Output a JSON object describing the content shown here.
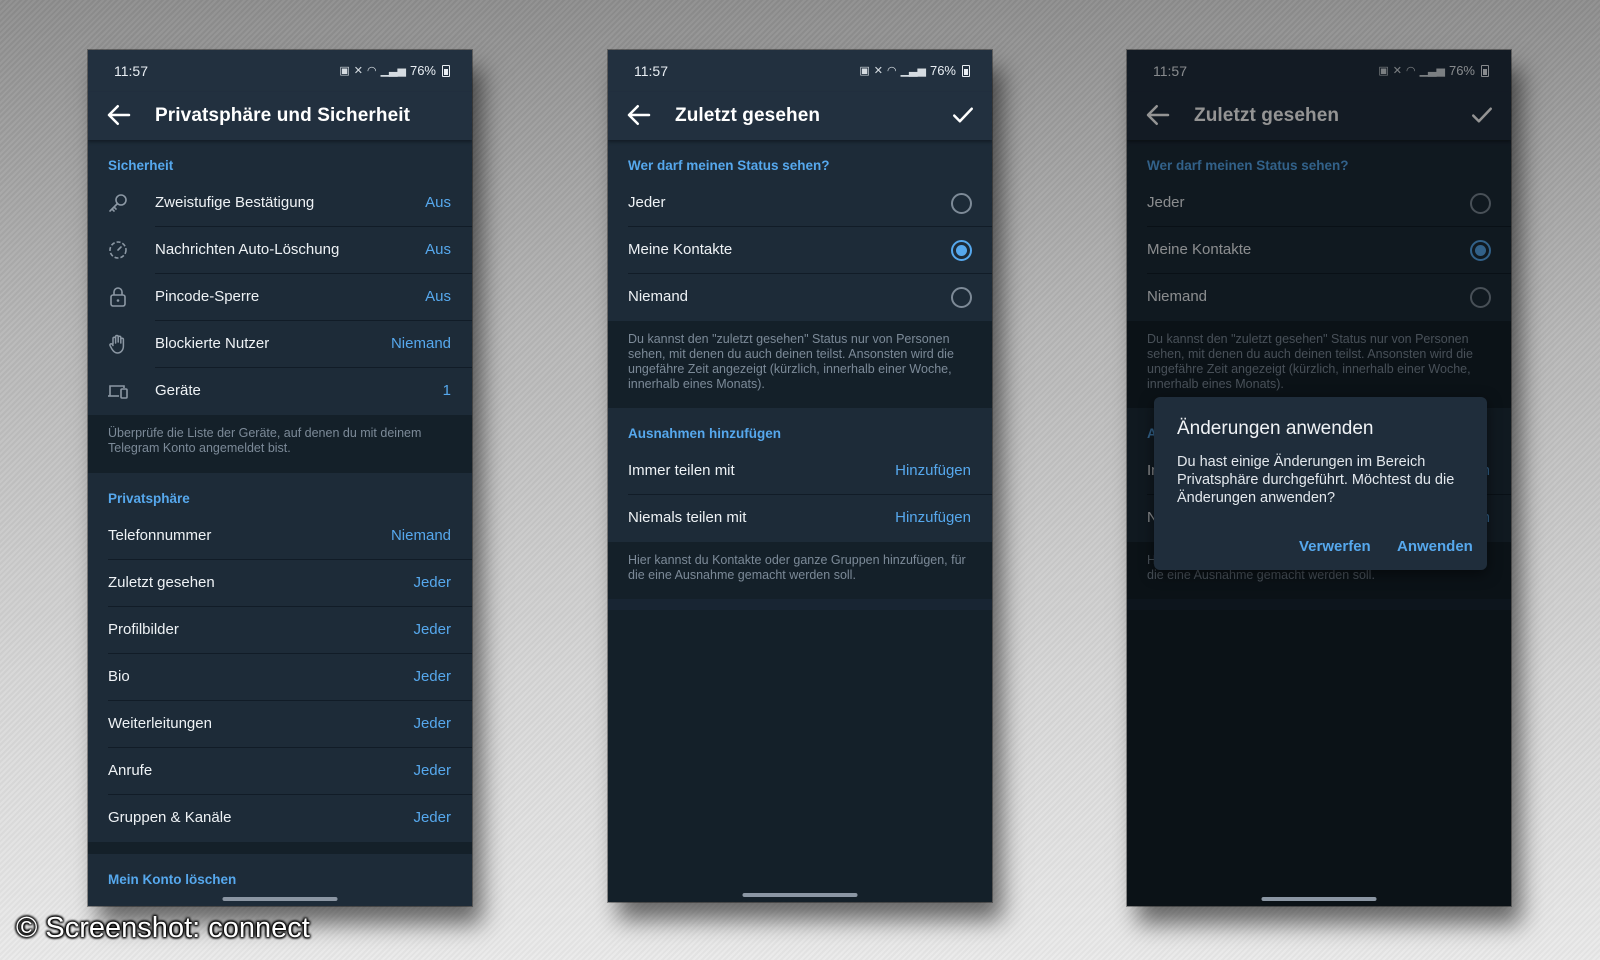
{
  "statusbar": {
    "time": "11:57",
    "battery": "76%"
  },
  "phone1": {
    "title": "Privatsphäre und Sicherheit",
    "security": {
      "header": "Sicherheit",
      "items": [
        {
          "label": "Zweistufige Bestätigung",
          "value": "Aus",
          "icon": "key-icon"
        },
        {
          "label": "Nachrichten Auto-Löschung",
          "value": "Aus",
          "icon": "timer-icon"
        },
        {
          "label": "Pincode-Sperre",
          "value": "Aus",
          "icon": "lock-icon"
        },
        {
          "label": "Blockierte Nutzer",
          "value": "Niemand",
          "icon": "hand-icon"
        },
        {
          "label": "Geräte",
          "value": "1",
          "icon": "devices-icon"
        }
      ],
      "info": "Überprüfe die Liste der Geräte, auf denen du mit deinem Telegram Konto angemeldet bist."
    },
    "privacy": {
      "header": "Privatsphäre",
      "items": [
        {
          "label": "Telefonnummer",
          "value": "Niemand"
        },
        {
          "label": "Zuletzt gesehen",
          "value": "Jeder"
        },
        {
          "label": "Profilbilder",
          "value": "Jeder"
        },
        {
          "label": "Bio",
          "value": "Jeder"
        },
        {
          "label": "Weiterleitungen",
          "value": "Jeder"
        },
        {
          "label": "Anrufe",
          "value": "Jeder"
        },
        {
          "label": "Gruppen & Kanäle",
          "value": "Jeder"
        }
      ]
    },
    "delete_header": "Mein Konto löschen"
  },
  "phone2": {
    "title": "Zuletzt gesehen",
    "question": "Wer darf meinen Status sehen?",
    "options": [
      {
        "label": "Jeder",
        "selected": false
      },
      {
        "label": "Meine Kontakte",
        "selected": true
      },
      {
        "label": "Niemand",
        "selected": false
      }
    ],
    "info": "Du kannst den \"zuletzt gesehen\" Status nur von Personen sehen, mit denen du auch deinen teilst. Ansonsten wird die ungefähre Zeit angezeigt (kürzlich, innerhalb einer Woche, innerhalb eines Monats).",
    "exceptions_header": "Ausnahmen hinzufügen",
    "exceptions": [
      {
        "label": "Immer teilen mit",
        "action": "Hinzufügen"
      },
      {
        "label": "Niemals teilen mit",
        "action": "Hinzufügen"
      }
    ],
    "exceptions_info": "Hier kannst du Kontakte oder ganze Gruppen hinzufügen, für die eine Ausnahme gemacht werden soll."
  },
  "dialog": {
    "title": "Änderungen anwenden",
    "text": "Du hast einige Änderungen im Bereich Privatsphäre durchgeführt. Möchtest du die Änderungen anwenden?",
    "discard": "Verwerfen",
    "apply": "Anwenden"
  },
  "watermark": "© Screenshot: connect",
  "colors": {
    "accent": "#56a8ed",
    "background": "#182533",
    "appbar": "#22303f"
  }
}
